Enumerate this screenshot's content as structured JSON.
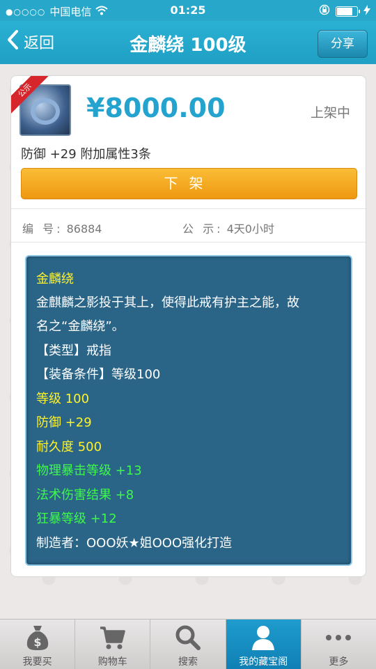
{
  "status_bar": {
    "carrier": "中国电信",
    "time": "01:25",
    "signal": "●○○○○"
  },
  "nav": {
    "back_label": "返回",
    "title": "金麟绕 100级",
    "share_label": "分享"
  },
  "item": {
    "badge": "公示",
    "price": "¥8000.00",
    "status": "上架中",
    "summary": "防御 +29  附加属性3条",
    "delist_label": "下架",
    "id_label": "编 号:",
    "id_value": "86884",
    "notice_label": "公 示:",
    "notice_value": "4天0小时"
  },
  "description": {
    "lines": [
      {
        "text": "金麟绕",
        "color": "#fff22a"
      },
      {
        "text": "金麒麟之影投于其上，使得此戒有护主之能，故",
        "color": "#ffffff"
      },
      {
        "text": "名之“金麟绕”。",
        "color": "#ffffff"
      },
      {
        "text": "【类型】戒指",
        "color": "#ffffff"
      },
      {
        "text": "【装备条件】等级100",
        "color": "#ffffff"
      },
      {
        "text": "等级 100",
        "color": "#fff22a"
      },
      {
        "text": "防御 +29",
        "color": "#fff22a"
      },
      {
        "text": "耐久度 500",
        "color": "#fff22a"
      },
      {
        "text": "物理暴击等级 +13",
        "color": "#3ef94a"
      },
      {
        "text": "法术伤害结果 +8",
        "color": "#3ef94a"
      },
      {
        "text": "狂暴等级 +12",
        "color": "#3ef94a"
      },
      {
        "text": "制造者：OOO妖★姐OOO强化打造",
        "color": "#ffffff"
      }
    ]
  },
  "tabs": [
    {
      "label": "我要买",
      "icon": "money-bag-icon"
    },
    {
      "label": "购物车",
      "icon": "cart-icon"
    },
    {
      "label": "搜索",
      "icon": "search-icon"
    },
    {
      "label": "我的藏宝阁",
      "icon": "user-icon",
      "active": true
    },
    {
      "label": "更多",
      "icon": "more-icon"
    }
  ]
}
